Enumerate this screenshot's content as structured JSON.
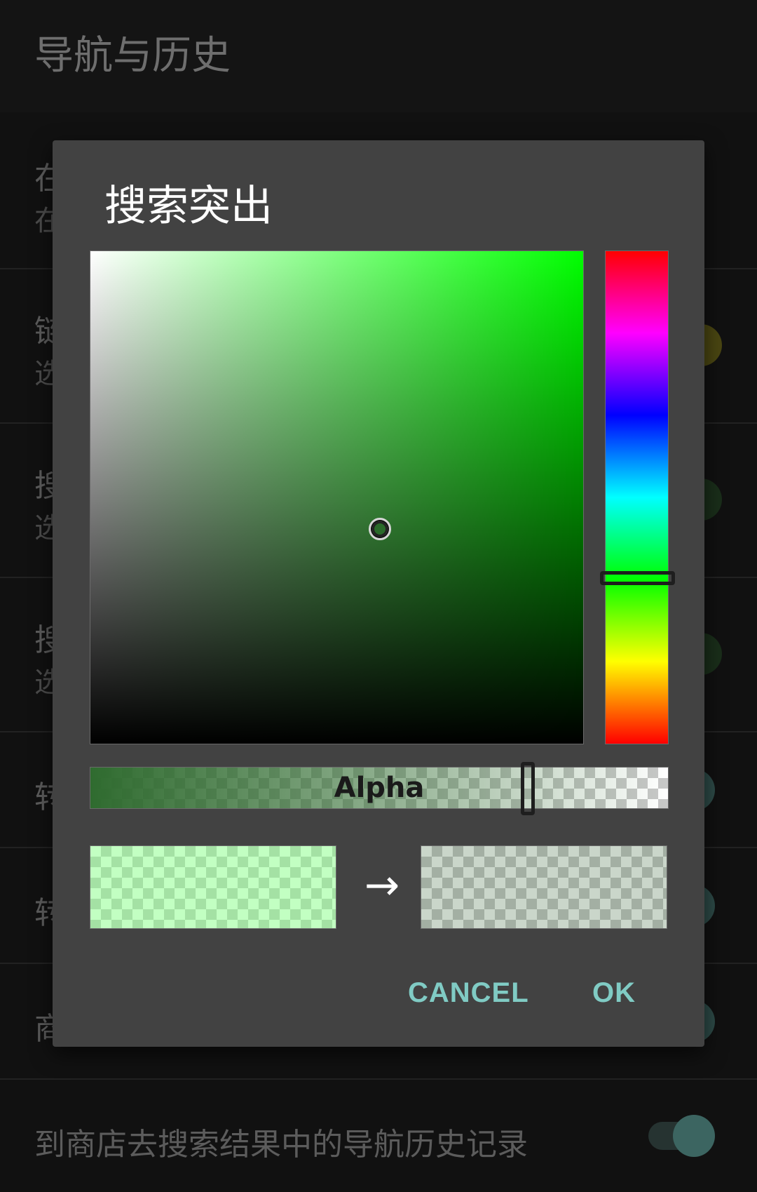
{
  "screen": {
    "title": "导航与历史",
    "rows": [
      {
        "title": "在",
        "subtitle": "在"
      },
      {
        "title": "链",
        "subtitle": "选"
      },
      {
        "title": "搜",
        "subtitle": "选"
      },
      {
        "title": "搜",
        "subtitle": "选"
      },
      {
        "title": "转"
      },
      {
        "title": "转"
      },
      {
        "title": "商"
      },
      {
        "title": "到商店去搜索结果中的导航历史记录"
      }
    ],
    "toggle_colors": [
      "#6b6018",
      "#1f4a1f",
      "#1f4a1f",
      "#3f6a66",
      "#3f6a66",
      "#3f6a66",
      "#3f6a66"
    ]
  },
  "dialog": {
    "title": "搜索突出",
    "alpha_label": "Alpha",
    "arrow": "→",
    "cancel_label": "CANCEL",
    "ok_label": "OK",
    "hue_color": "#00ff00",
    "selected_color": "#2a6a2a",
    "accent_color": "#80cbc4"
  }
}
